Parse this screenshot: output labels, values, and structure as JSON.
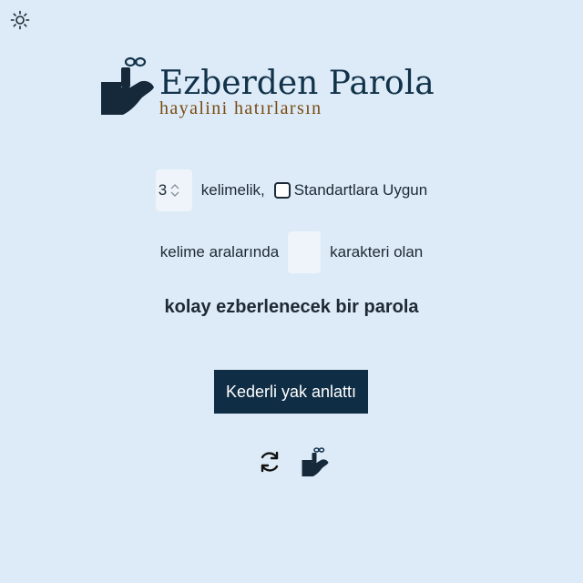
{
  "header": {
    "theme_icon": "sun-icon"
  },
  "logo": {
    "title": "Ezberden Parola",
    "subtitle": "hayalini hatırlarsın",
    "icon": "finger-string-reminder-icon"
  },
  "options": {
    "word_count_value": "3",
    "word_count_suffix": "kelimelik,",
    "standards_label": "Standartlara Uygun",
    "standards_checked": false,
    "separator_prefix": "kelime aralarında",
    "separator_value": "",
    "separator_suffix": "karakteri olan",
    "tagline": "kolay ezberlenecek bir parola"
  },
  "actions": {
    "generate_label": "Kederli yak anlattı",
    "refresh_icon": "refresh-icon",
    "remember_icon": "finger-string-reminder-icon"
  },
  "colors": {
    "background": "#dcebf7",
    "brand_dark": "#0f2d45",
    "brand_brown": "#7a4a10"
  }
}
